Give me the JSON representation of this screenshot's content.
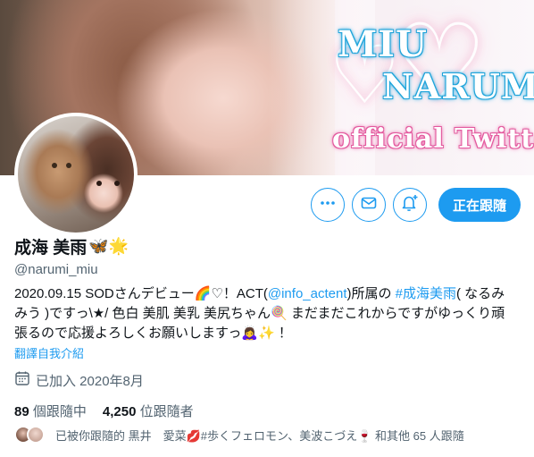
{
  "banner": {
    "line1": "MIU",
    "line2": "NARUMI",
    "line3": "official Twitter"
  },
  "profile": {
    "display_name": "成海 美雨",
    "name_emojis": "🦋🌟",
    "handle": "@narumi_miu",
    "follow_button_label": "正在跟隨"
  },
  "bio": {
    "part1": "2020.09.15 SODさんデビュー🌈♡！ACT(",
    "mention": "@info_actent",
    "part2": ")所属の ",
    "hashtag": "#成海美雨",
    "part3": "( なるみみう )ですっ\\★/ 色白 美肌 美乳 美尻ちゃん🍭 まだまだこれからですがゆっくり頑張るので応援よろしくお願いしますっ🙇‍♀️✨ ！",
    "translate_label": "翻譯自我介紹"
  },
  "joined": {
    "label": "已加入 2020年8月"
  },
  "stats": {
    "following_count": "89",
    "following_label": "個跟隨中",
    "followers_count": "4,250",
    "followers_label": "位跟隨者"
  },
  "followed_by": {
    "text": "已被你跟隨的 黒井　愛菜💋#歩くフェロモン、美波こづえ🍷 和其他 65 人跟隨"
  },
  "icons": [
    "more-icon",
    "mail-icon",
    "bell-plus-icon",
    "calendar-icon"
  ],
  "colors": {
    "accent": "#1d9bf0",
    "text_primary": "#0f1419",
    "text_secondary": "#536471"
  }
}
